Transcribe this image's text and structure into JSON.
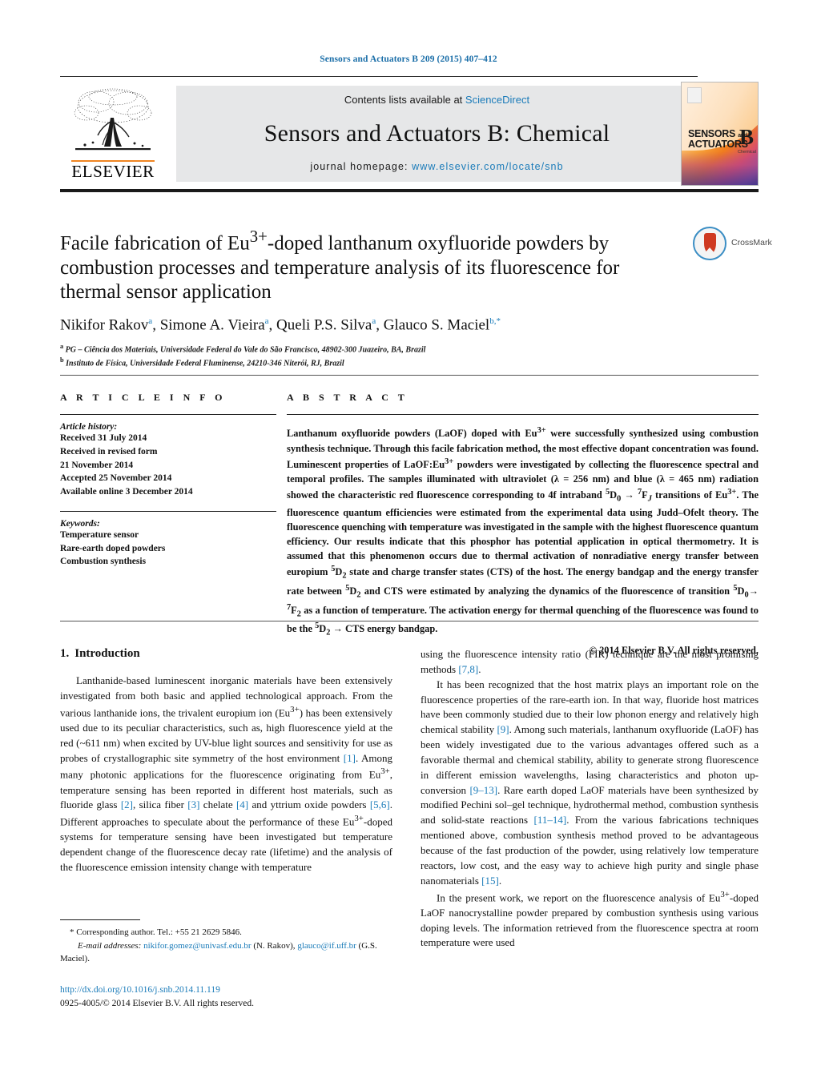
{
  "running_head": "Sensors and Actuators B 209 (2015) 407–412",
  "masthead": {
    "contents_prefix": "Contents lists available at ",
    "sciencedirect": "ScienceDirect",
    "journal_title": "Sensors and Actuators B: Chemical",
    "homepage_label": "journal homepage:",
    "homepage_url": "www.elsevier.com/locate/snb",
    "publisher": "ELSEVIER",
    "cover": {
      "word1": "SENSORS",
      "and": "and",
      "word2": "ACTUATORS",
      "letter": "B",
      "subtitle": "Chemical"
    },
    "accent_orange": "#f08521",
    "link_blue": "#1a7bb9"
  },
  "article": {
    "title": "Facile fabrication of Eu3+-doped lanthanum oxyfluoride powders by combustion processes and temperature analysis of its fluorescence for thermal sensor application",
    "crossmark_label": "CrossMark",
    "authors_plain": "Nikifor Rakova, Simone A. Vieiraa, Queli P.S. Silvaa, Glauco S. Macielb,*",
    "affiliations": [
      "a PG – Ciência dos Materiais, Universidade Federal do Vale do São Francisco, 48902-300 Juazeiro, BA, Brazil",
      "b Instituto de Física, Universidade Federal Fluminense, 24210-346 Niterói, RJ, Brazil"
    ]
  },
  "article_info": {
    "heading": "A R T I C L E   I N F O",
    "history_label": "Article history:",
    "history_lines": [
      "Received 31 July 2014",
      "Received in revised form",
      "21 November 2014",
      "Accepted 25 November 2014",
      "Available online 3 December 2014"
    ],
    "keywords_label": "Keywords:",
    "keywords": [
      "Temperature sensor",
      "Rare-earth doped powders",
      "Combustion synthesis"
    ]
  },
  "abstract": {
    "heading": "A B S T R A C T",
    "text": "Lanthanum oxyfluoride powders (LaOF) doped with Eu3+ were successfully synthesized using combustion synthesis technique. Through this facile fabrication method, the most effective dopant concentration was found. Luminescent properties of LaOF:Eu3+ powders were investigated by collecting the fluorescence spectral and temporal profiles. The samples illuminated with ultraviolet (λ = 256 nm) and blue (λ = 465 nm) radiation showed the characteristic red fluorescence corresponding to 4f intraband 5D0 → 7FJ transitions of Eu3+. The fluorescence quantum efficiencies were estimated from the experimental data using Judd–Ofelt theory. The fluorescence quenching with temperature was investigated in the sample with the highest fluorescence quantum efficiency. Our results indicate that this phosphor has potential application in optical thermometry. It is assumed that this phenomenon occurs due to thermal activation of nonradiative energy transfer between europium 5D2 state and charge transfer states (CTS) of the host. The energy bandgap and the energy transfer rate between 5D2 and CTS were estimated by analyzing the dynamics of the fluorescence of transition 5D0 → 7F2 as a function of temperature. The activation energy for thermal quenching of the fluorescence was found to be the 5D2 → CTS energy bandgap.",
    "copyright": "© 2014 Elsevier B.V. All rights reserved."
  },
  "introduction": {
    "number": "1.",
    "heading": "Introduction",
    "left_paragraphs": [
      "Lanthanide-based luminescent inorganic materials have been extensively investigated from both basic and applied technological approach. From the various lanthanide ions, the trivalent europium ion (Eu3+) has been extensively used due to its peculiar characteristics, such as, high fluorescence yield at the red (~611 nm) when excited by UV-blue light sources and sensitivity for use as probes of crystallographic site symmetry of the host environment [1]. Among many photonic applications for the fluorescence originating from Eu3+, temperature sensing has been reported in different host materials, such as fluoride glass [2], silica fiber [3] chelate [4] and yttrium oxide powders [5,6]. Different approaches to speculate about the performance of these Eu3+-doped systems for temperature sensing have been investigated but temperature dependent change of the fluorescence decay rate (lifetime) and the analysis of the fluorescence emission intensity change with temperature"
    ],
    "right_paragraphs": [
      "using the fluorescence intensity ratio (FIR) technique are the most promising methods [7,8].",
      "It has been recognized that the host matrix plays an important role on the fluorescence properties of the rare-earth ion. In that way, fluoride host matrices have been commonly studied due to their low phonon energy and relatively high chemical stability [9]. Among such materials, lanthanum oxyfluoride (LaOF) has been widely investigated due to the various advantages offered such as a favorable thermal and chemical stability, ability to generate strong fluorescence in different emission wavelengths, lasing characteristics and photon up-conversion [9–13]. Rare earth doped LaOF materials have been synthesized by modified Pechini sol–gel technique, hydrothermal method, combustion synthesis and solid-state reactions [11–14]. From the various fabrications techniques mentioned above, combustion synthesis method proved to be advantageous because of the fast production of the powder, using relatively low temperature reactors, low cost, and the easy way to achieve high purity and single phase nanomaterials [15].",
      "In the present work, we report on the fluorescence analysis of Eu3+-doped LaOF nanocrystalline powder prepared by combustion synthesis using various doping levels. The information retrieved from the fluorescence spectra at room temperature were used"
    ]
  },
  "footnote": {
    "corresponding": "* Corresponding author. Tel.: +55 21 2629 5846.",
    "email_label": "E-mail addresses:",
    "email1": "nikifor.gomez@univasf.edu.br",
    "email1_owner": "(N. Rakov),",
    "email2": "glauco@if.uff.br",
    "email2_owner": "(G.S. Maciel)."
  },
  "doi_block": {
    "doi": "http://dx.doi.org/10.1016/j.snb.2014.11.119",
    "issn": "0925-4005/© 2014 Elsevier B.V. All rights reserved."
  }
}
